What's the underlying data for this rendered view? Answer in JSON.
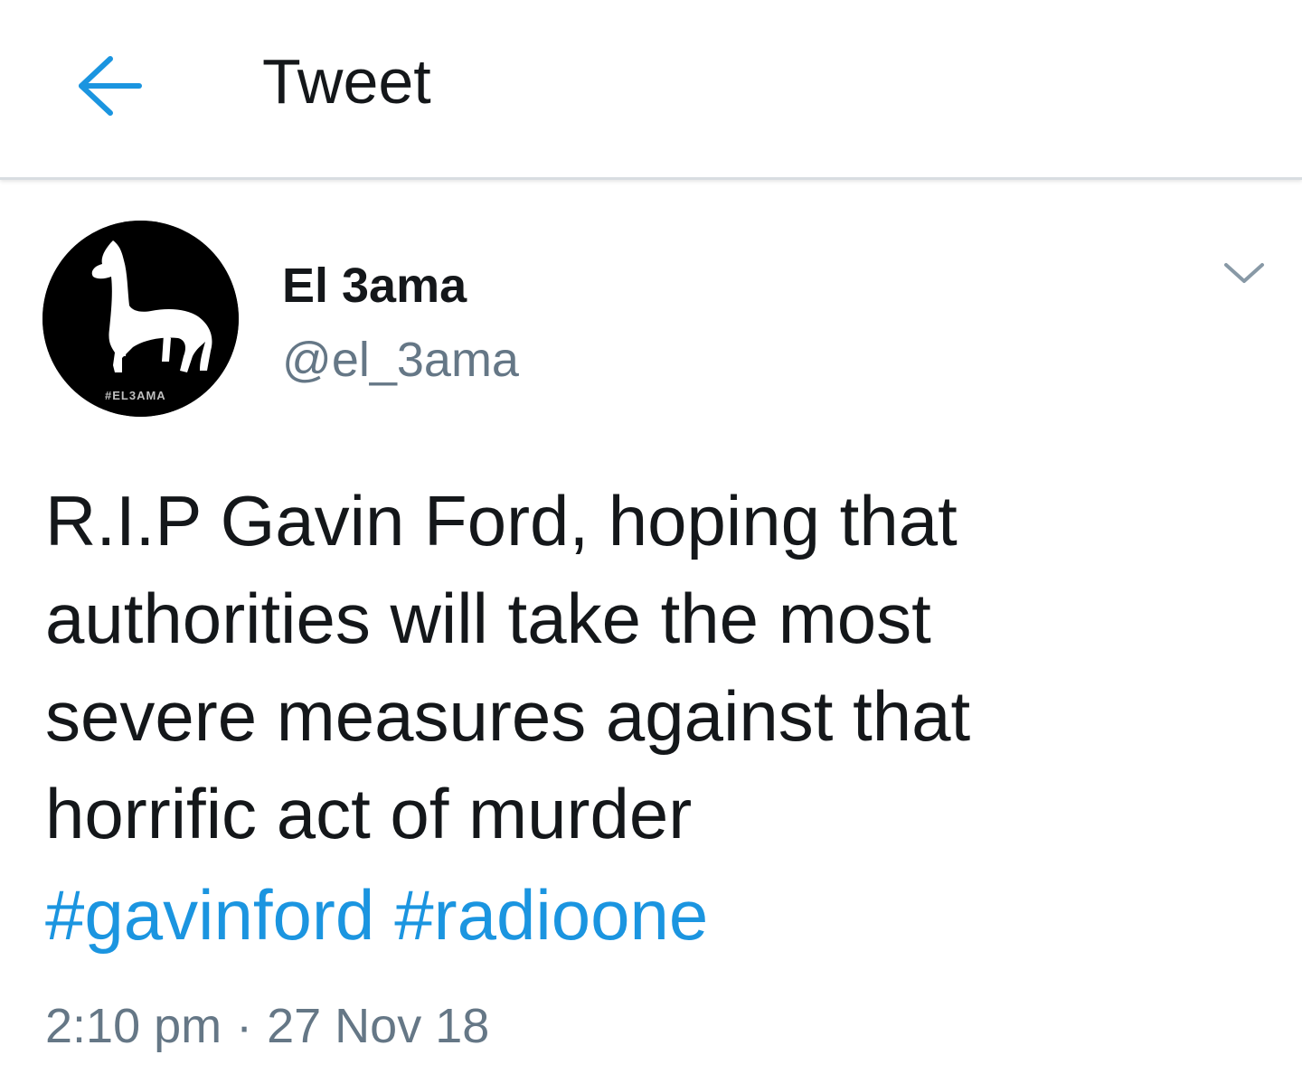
{
  "appbar": {
    "title": "Tweet",
    "back_icon": "arrow-left-icon",
    "accent_color": "#1b95e0"
  },
  "tweet": {
    "author": {
      "display_name": "El 3ama",
      "handle": "@el_3ama",
      "avatar_icon": "llama-logo-icon",
      "avatar_caption": "#EL3AMA"
    },
    "menu_icon": "chevron-down-icon",
    "text_lines": [
      "R.I.P Gavin Ford, hoping that",
      "authorities will take the most",
      "severe measures against that",
      "horrific act of murder"
    ],
    "hashtags": [
      "#gavinford",
      "#radioone"
    ],
    "time": "2:10 pm",
    "separator": "·",
    "date": "27 Nov 18",
    "hashtag_color": "#1b95e0",
    "secondary_color": "#657786"
  }
}
